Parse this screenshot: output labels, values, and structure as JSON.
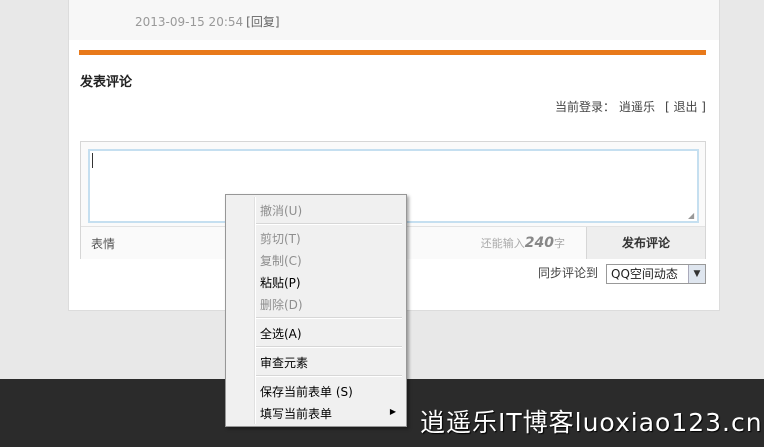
{
  "previous_comment": {
    "timestamp": "2013-09-15 20:54",
    "reply_label": "[回复]"
  },
  "comment_form": {
    "title": "发表评论",
    "login_label": "当前登录：",
    "username": "逍遥乐",
    "logout_label": "[ 退出 ]",
    "emoji_label": "表情",
    "remaining_prefix": "还能输入",
    "remaining_count": "240",
    "remaining_suffix": "字",
    "publish_label": "发布评论",
    "sync_label": "同步评论到",
    "sync_selected": "QQ空间动态"
  },
  "context_menu": {
    "undo": "撤消(U)",
    "cut": "剪切(T)",
    "copy": "复制(C)",
    "paste": "粘贴(P)",
    "delete": "删除(D)",
    "select_all": "全选(A)",
    "inspect": "审查元素",
    "save_form": "保存当前表单 (S)",
    "fill_form": "填写当前表单"
  },
  "watermark": "逍遥乐IT博客luoxiao123.cn",
  "colors": {
    "accent_bar": "#e8791a",
    "footer_bg": "#2b2b2b",
    "textarea_border": "#c5dff0"
  },
  "icons": {
    "submenu_arrow": "triangle-right-icon",
    "select_arrow": "chevron-down-icon"
  }
}
